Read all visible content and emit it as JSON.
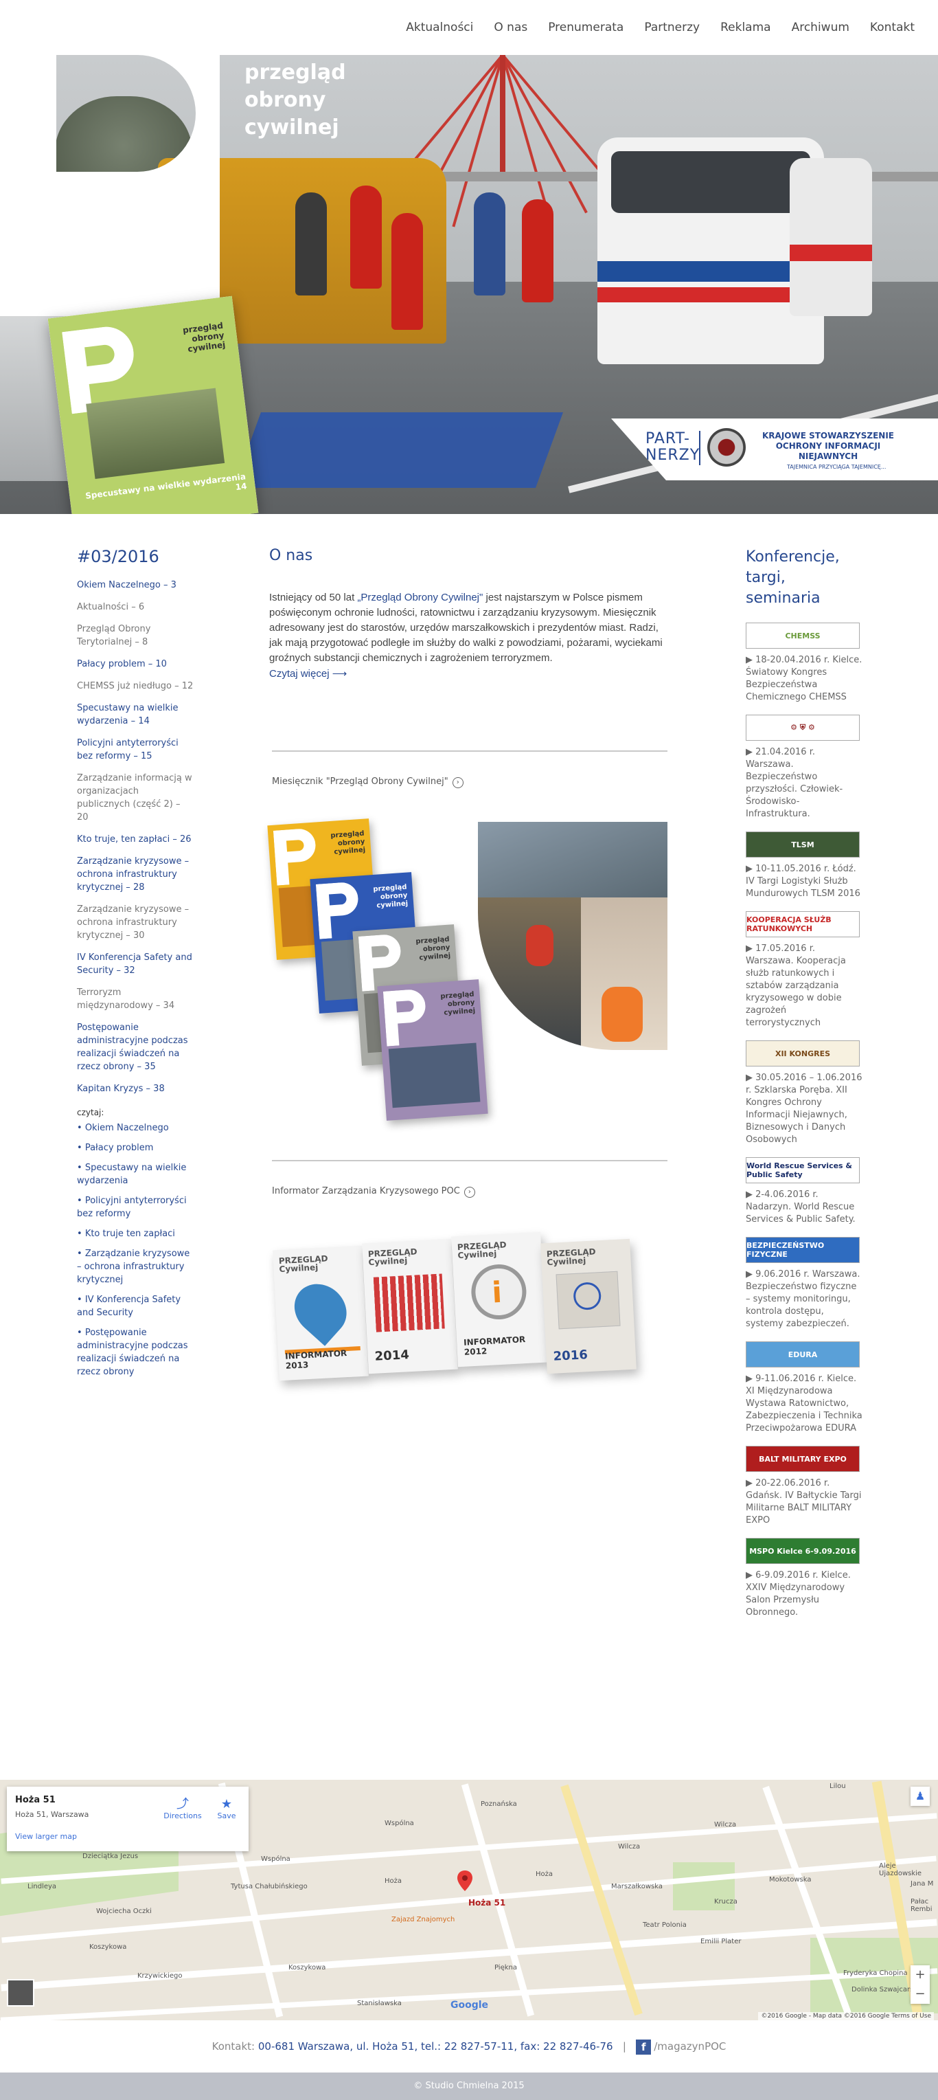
{
  "nav": [
    "Aktualności",
    "O nas",
    "Prenumerata",
    "Partnerzy",
    "Reklama",
    "Archiwum",
    "Kontakt"
  ],
  "brand": {
    "line1": "przegląd",
    "line2": "obrony",
    "line3": "cywilnej"
  },
  "magazine": {
    "title1": "przegląd",
    "title2": "obrony",
    "title3": "cywilnej",
    "caption": "Specustawy na wielkie wydarzenia 14"
  },
  "partners": {
    "label1": "PART-",
    "label2": "NERZY",
    "name1": "KRAJOWE STOWARZYSZENIE",
    "name2": "OCHRONY INFORMACJI NIEJAWNYCH",
    "tagline": "TAJEMNICA PRZYCIĄGA TAJEMNICĘ..."
  },
  "issue": {
    "title": "#03/2016",
    "toc": [
      {
        "text": "Okiem Naczelnego – 3",
        "link": true
      },
      {
        "text": "Aktualności – 6",
        "link": false
      },
      {
        "text": "Przegląd Obrony Terytorialnej – 8",
        "link": false
      },
      {
        "text": "Pałacy problem – 10",
        "link": true
      },
      {
        "text": "CHEMSS już niedługo – 12",
        "link": false
      },
      {
        "text": "Specustawy na wielkie wydarzenia – 14",
        "link": true
      },
      {
        "text": "Policyjni antyterroryści bez reformy – 15",
        "link": true
      },
      {
        "text": "Zarządzanie informacją w organizacjach publicznych (część 2) – 20",
        "link": false
      },
      {
        "text": "Kto truje, ten zapłaci – 26",
        "link": true
      },
      {
        "text": "Zarządzanie kryzysowe – ochrona infrastruktury krytycznej – 28",
        "link": true
      },
      {
        "text": "Zarządzanie kryzysowe – ochrona infrastruktury krytycznej – 30",
        "link": false
      },
      {
        "text": "IV Konferencja Safety and Security – 32",
        "link": true
      },
      {
        "text": "Terroryzm międzynarodowy – 34",
        "link": false
      },
      {
        "text": "Postępowanie administracyjne podczas realizacji świadczeń na rzecz obrony – 35",
        "link": true
      },
      {
        "text": "Kapitan Kryzys – 38",
        "link": true
      }
    ],
    "read_label": "czytaj:",
    "reads": [
      "Okiem Naczelnego",
      "Pałacy problem",
      "Specustawy na wielkie wydarzenia",
      "Policyjni antyterroryści bez reformy",
      "Kto truje ten zapłaci",
      "Zarządzanie kryzysowe – ochrona infrastruktury krytycznej",
      "IV Konferencja Safety and Security",
      "Postępowanie administracyjne podczas realizacji świadczeń na rzecz obrony"
    ]
  },
  "about": {
    "title": "O nas",
    "text_before": "Istniejący od 50 lat ",
    "quote": "„Przegląd Obrony Cywilnej\"",
    "text_after": " jest najstarszym w Polsce pismem poświęconym ochronie ludności, ratownictwu i zarządzaniu kryzysowym. Miesięcznik adresowany jest do starostów, urzędów marszałkowskich i prezydentów miast. Radzi, jak mają przygotować podległe im służby do walki z powodziami, pożarami, wyciekami groźnych substancji chemicznych i zagrożeniem terroryzmem.",
    "more": "Czytaj więcej ⟶",
    "monthly_link": "Miesięcznik \"Przegląd Obrony Cywilnej\"",
    "info_link": "Informator Zarządzania Kryzysowego POC",
    "arrow": "›",
    "cover_title1": "przegląd",
    "cover_title2": "obrony",
    "cover_title3": "cywilnej",
    "informators": [
      {
        "year": "INFORMATOR 2013"
      },
      {
        "year": "2014"
      },
      {
        "year": "INFORMATOR 2012"
      },
      {
        "year": "2016"
      }
    ],
    "informator_brand": "PRZEGLĄD Cywilnej"
  },
  "events": {
    "title": "Konferencje, targi, seminaria",
    "items": [
      {
        "banner": "CHEMSS",
        "text": "▶ 18-20.04.2016 r. Kielce. Światowy Kongres Bezpieczeństwa Chemicznego CHEMSS",
        "bg": "#ffffff",
        "fg": "#6a9a3a"
      },
      {
        "banner": "⚙ ⛨ ⚙",
        "text": "▶ 21.04.2016 r. Warszawa. Bezpieczeństwo przyszłości. Człowiek-Środowisko-Infrastruktura.",
        "bg": "#ffffff",
        "fg": "#8a1a1a"
      },
      {
        "banner": "TLSM",
        "text": "▶ 10-11.05.2016 r. Łódź. IV Targi Logistyki Służb Mundurowych TLSM 2016",
        "bg": "#3e5a36",
        "fg": "#ffffff"
      },
      {
        "banner": "KOOPERACJA SŁUŻB RATUNKOWYCH",
        "text": "▶ 17.05.2016 r. Warszawa. Kooperacja służb ratunkowych i sztabów zarządzania kryzysowego w dobie zagrożeń terrorystycznych",
        "bg": "#ffffff",
        "fg": "#c62828"
      },
      {
        "banner": "XII KONGRES",
        "text": "▶ 30.05.2016 – 1.06.2016 r. Szklarska Poręba. XII Kongres Ochrony Informacji Niejawnych, Biznesowych i Danych Osobowych",
        "bg": "#f7f1e0",
        "fg": "#7a4a1a"
      },
      {
        "banner": "World Rescue Services & Public Safety",
        "text": "▶ 2-4.06.2016 r. Nadarzyn. World Rescue Services & Public Safety.",
        "bg": "#ffffff",
        "fg": "#1b2f6a"
      },
      {
        "banner": "BEZPIECZEŃSTWO FIZYCZNE",
        "text": "▶ 9.06.2016 r. Warszawa. Bezpieczeństwo fizyczne – systemy monitoringu, kontrola dostępu, systemy zabezpieczeń.",
        "bg": "#2f6cc0",
        "fg": "#ffffff"
      },
      {
        "banner": "EDURA",
        "text": "▶ 9-11.06.2016 r. Kielce. XI Międzynarodowa Wystawa Ratownictwo, Zabezpieczenia i Technika Przeciwpożarowa EDURA",
        "bg": "#5aa0d8",
        "fg": "#ffffff"
      },
      {
        "banner": "BALT MILITARY EXPO",
        "text": "▶ 20-22.06.2016 r. Gdańsk. IV Bałtyckie Targi Militarne BALT MILITARY EXPO",
        "bg": "#b01e1e",
        "fg": "#ffffff"
      },
      {
        "banner": "MSPO Kielce 6-9.09.2016",
        "text": "▶ 6-9.09.2016 r. Kielce. XXIV Międzynarodowy Salon Przemysłu Obronnego.",
        "bg": "#2e7d32",
        "fg": "#ffffff"
      }
    ]
  },
  "map": {
    "name": "Hoża 51",
    "address": "Hoża 51, Warszawa",
    "view_larger": "View larger map",
    "directions": "Directions",
    "save": "Save",
    "pin_label": "Hoża 51",
    "google": "Google",
    "attribution": "©2016 Google - Map data ©2016 Google   Terms of Use",
    "streets": [
      "Wspólna",
      "Hoża",
      "Wilcza",
      "Krucza",
      "Poznańska",
      "Koszykowa",
      "Piękna",
      "Marszałkowska",
      "Mokotowska",
      "Emilii Plater",
      "Dzieciątka Jezus",
      "Wojciecha Oczki",
      "Lindleya",
      "Tytusa Chałubińskiego",
      "Zajazd Znajomych",
      "Teatr Polonia",
      "Lilou",
      "Fryderyka Chopina",
      "Dolinka Szwajcarska",
      "Jana M",
      "Pałac Rembi",
      "Aleje Ujazdowskie",
      "Krzywickiego",
      "Stanisławska"
    ]
  },
  "footer": {
    "contact_label": "Kontakt: ",
    "contact_value": "00-681 Warszawa, ul. Hoża 51, tel.: 22 827-57-11, fax: 22 827-46-76",
    "sep": "|",
    "fb_icon_letter": "f",
    "fb_label": "/magazynPOC",
    "copyright": "© Studio Chmielna 2015"
  }
}
